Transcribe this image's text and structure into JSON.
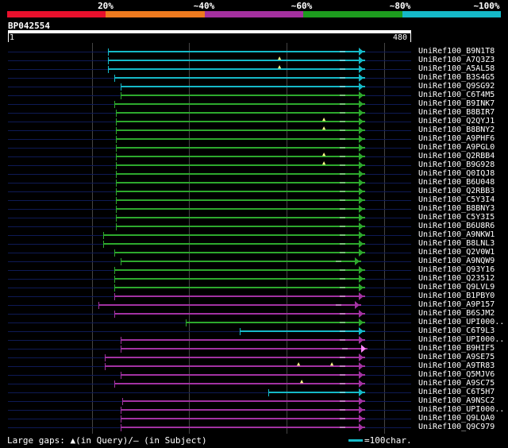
{
  "legend": {
    "labels": [
      "20%",
      "~40%",
      "~60%",
      "~80%",
      "~100%"
    ],
    "colors": [
      "#e8102c",
      "#ee7a1f",
      "#a4309f",
      "#1d9c1e",
      "#15b9c8"
    ]
  },
  "query": {
    "id": "BP042554",
    "start": "1",
    "end": "480"
  },
  "colors": {
    "c": "#15b9c8",
    "g": "#2da82d",
    "m": "#a232a2",
    "arrow_hot": "#ff88ff"
  },
  "rows": [
    {
      "name": "UniRef100_B9N1T8",
      "start": 136,
      "end": 460,
      "color": "c",
      "marks": []
    },
    {
      "name": "UniRef100_A7Q3Z3",
      "start": 136,
      "end": 460,
      "color": "c",
      "marks": [
        352
      ]
    },
    {
      "name": "UniRef100_A5AL58",
      "start": 136,
      "end": 460,
      "color": "c",
      "marks": [
        352
      ]
    },
    {
      "name": "UniRef100_B3S4G5",
      "start": 144,
      "end": 460,
      "color": "c",
      "marks": []
    },
    {
      "name": "UniRef100_Q9SG92",
      "start": 152,
      "end": 460,
      "color": "c",
      "marks": []
    },
    {
      "name": "UniRef100_C6T4M5",
      "start": 152,
      "end": 460,
      "color": "g",
      "marks": []
    },
    {
      "name": "UniRef100_B9INK7",
      "start": 144,
      "end": 460,
      "color": "g",
      "marks": []
    },
    {
      "name": "UniRef100_B8BIR7",
      "start": 146,
      "end": 460,
      "color": "g",
      "marks": []
    },
    {
      "name": "UniRef100_Q2QYJ1",
      "start": 146,
      "end": 460,
      "color": "g",
      "marks": [
        408
      ]
    },
    {
      "name": "UniRef100_B8BNY2",
      "start": 146,
      "end": 460,
      "color": "g",
      "marks": [
        408
      ]
    },
    {
      "name": "UniRef100_A9PHF6",
      "start": 146,
      "end": 460,
      "color": "g",
      "marks": []
    },
    {
      "name": "UniRef100_A9PGL0",
      "start": 146,
      "end": 460,
      "color": "g",
      "marks": []
    },
    {
      "name": "UniRef100_Q2RBB4",
      "start": 146,
      "end": 460,
      "color": "g",
      "marks": [
        408
      ]
    },
    {
      "name": "UniRef100_B9G928",
      "start": 146,
      "end": 460,
      "color": "g",
      "marks": [
        408
      ]
    },
    {
      "name": "UniRef100_Q0IQJ8",
      "start": 146,
      "end": 460,
      "color": "g",
      "marks": []
    },
    {
      "name": "UniRef100_B6U048",
      "start": 146,
      "end": 460,
      "color": "g",
      "marks": []
    },
    {
      "name": "UniRef100_Q2RBB3",
      "start": 146,
      "end": 460,
      "color": "g",
      "marks": []
    },
    {
      "name": "UniRef100_C5Y3I4",
      "start": 146,
      "end": 460,
      "color": "g",
      "marks": []
    },
    {
      "name": "UniRef100_B8BNY3",
      "start": 146,
      "end": 460,
      "color": "g",
      "marks": []
    },
    {
      "name": "UniRef100_C5Y3I5",
      "start": 146,
      "end": 460,
      "color": "g",
      "marks": []
    },
    {
      "name": "UniRef100_B6U8R6",
      "start": 146,
      "end": 460,
      "color": "g",
      "marks": []
    },
    {
      "name": "UniRef100_A9NKW1",
      "start": 130,
      "end": 460,
      "color": "g",
      "marks": []
    },
    {
      "name": "UniRef100_B8LNL3",
      "start": 130,
      "end": 460,
      "color": "g",
      "marks": []
    },
    {
      "name": "UniRef100_Q2V0W1",
      "start": 144,
      "end": 460,
      "color": "g",
      "marks": []
    },
    {
      "name": "UniRef100_A9NQW9",
      "start": 152,
      "end": 455,
      "color": "g",
      "marks": []
    },
    {
      "name": "UniRef100_Q93Y16",
      "start": 144,
      "end": 460,
      "color": "g",
      "marks": []
    },
    {
      "name": "UniRef100_Q23512",
      "start": 144,
      "end": 460,
      "color": "g",
      "marks": []
    },
    {
      "name": "UniRef100_Q9LVL9",
      "start": 144,
      "end": 460,
      "color": "g",
      "marks": []
    },
    {
      "name": "UniRef100_B1PBY0",
      "start": 144,
      "end": 460,
      "color": "m",
      "marks": []
    },
    {
      "name": "UniRef100_A9P157",
      "start": 124,
      "end": 455,
      "color": "m",
      "marks": []
    },
    {
      "name": "UniRef100_B6SJM2",
      "start": 144,
      "end": 460,
      "color": "m",
      "marks": []
    },
    {
      "name": "UniRef100_UPI000..",
      "start": 234,
      "end": 460,
      "color": "g",
      "marks": []
    },
    {
      "name": "UniRef100_C6T9L3",
      "start": 302,
      "end": 460,
      "color": "c",
      "marks": []
    },
    {
      "name": "UniRef100_UPI000..",
      "start": 152,
      "end": 460,
      "color": "m",
      "marks": []
    },
    {
      "name": "UniRef100_B9HIF5",
      "start": 152,
      "end": 463,
      "color": "m",
      "marks": [],
      "hot": true
    },
    {
      "name": "UniRef100_A9SE75",
      "start": 132,
      "end": 460,
      "color": "m",
      "marks": []
    },
    {
      "name": "UniRef100_A9TR83",
      "start": 132,
      "end": 460,
      "color": "m",
      "marks": [
        376,
        418
      ]
    },
    {
      "name": "UniRef100_Q5MJV6",
      "start": 152,
      "end": 460,
      "color": "m",
      "marks": []
    },
    {
      "name": "UniRef100_A9SC75",
      "start": 144,
      "end": 460,
      "color": "m",
      "marks": [
        380
      ]
    },
    {
      "name": "UniRef100_C6T5H7",
      "start": 338,
      "end": 460,
      "color": "c",
      "marks": []
    },
    {
      "name": "UniRef100_A9NSC2",
      "start": 154,
      "end": 460,
      "color": "m",
      "marks": []
    },
    {
      "name": "UniRef100_UPI000..",
      "start": 152,
      "end": 460,
      "color": "m",
      "marks": []
    },
    {
      "name": "UniRef100_Q9LQA0",
      "start": 152,
      "end": 460,
      "color": "m",
      "marks": []
    },
    {
      "name": "UniRef100_Q9C979",
      "start": 152,
      "end": 460,
      "color": "m",
      "marks": []
    }
  ],
  "footer": {
    "gaps_text": "Large gaps: ▲(in Query)/– (in Subject)",
    "scale_label": "=100char."
  }
}
